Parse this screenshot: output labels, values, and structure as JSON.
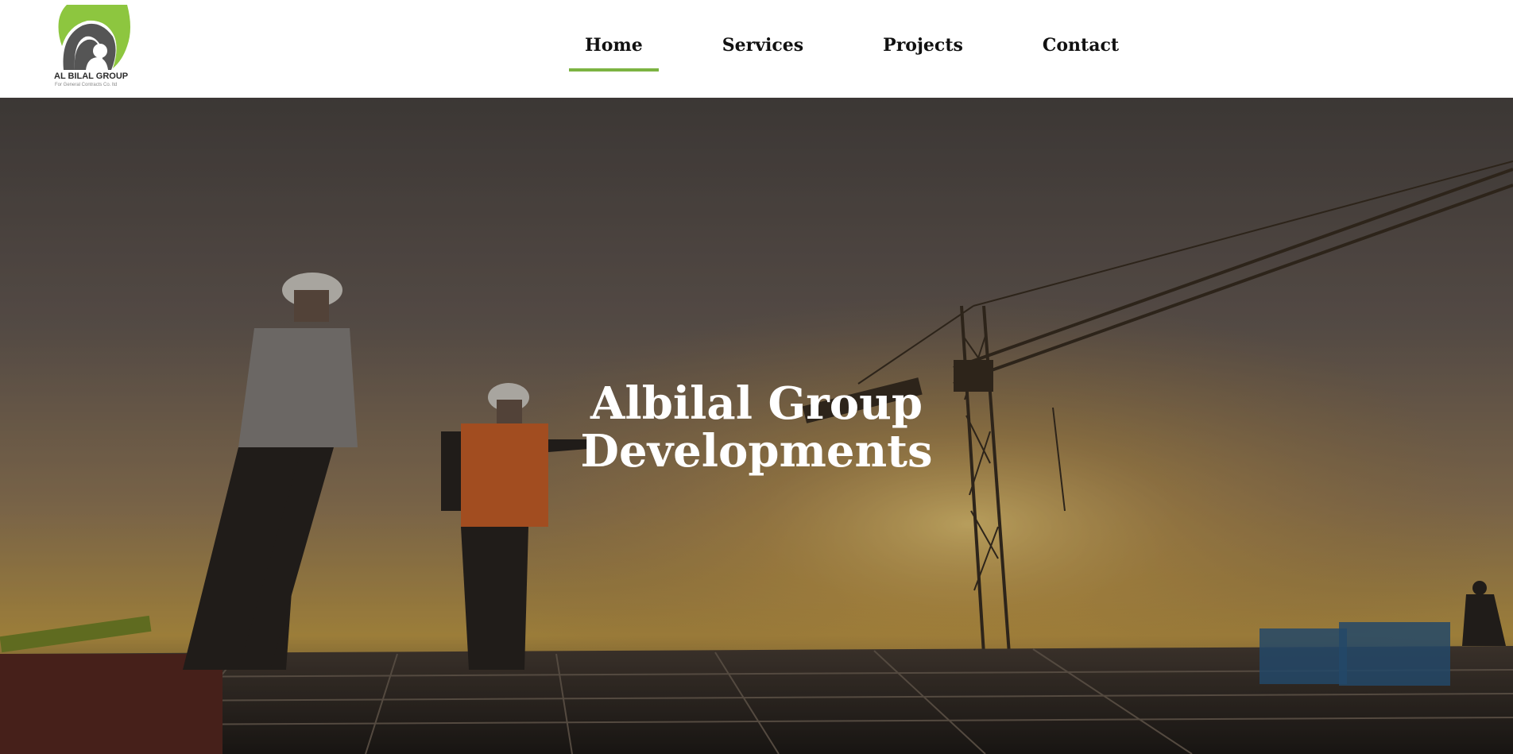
{
  "brand": {
    "name": "AL BILAL GROUP",
    "tagline": "For General Contracts Co. ltd",
    "colors": {
      "green": "#8dc63f",
      "dark": "#555555"
    }
  },
  "nav": {
    "items": [
      {
        "label": "Home",
        "active": true
      },
      {
        "label": "Services",
        "active": false
      },
      {
        "label": "Projects",
        "active": false
      },
      {
        "label": "Contact",
        "active": false
      }
    ],
    "accent": "#7cb342"
  },
  "hero": {
    "title_line1": "Albilal Group",
    "title_line2": "Developments",
    "background": "construction-site-sunset-photo"
  }
}
